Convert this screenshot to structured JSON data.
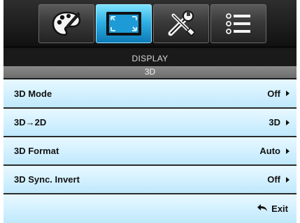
{
  "tabs": [
    {
      "icon": "palette-icon",
      "active": false
    },
    {
      "icon": "display-icon",
      "active": true
    },
    {
      "icon": "tools-icon",
      "active": false
    },
    {
      "icon": "list-icon",
      "active": false
    }
  ],
  "header": {
    "title": "DISPLAY",
    "subtitle": "3D"
  },
  "menu": {
    "items": [
      {
        "label": "3D Mode",
        "value": "Off"
      },
      {
        "label": "3D→2D",
        "value": "3D"
      },
      {
        "label": "3D Format",
        "value": "Auto"
      },
      {
        "label": "3D Sync. Invert",
        "value": "Off"
      }
    ],
    "exit_label": "Exit"
  },
  "colors": {
    "active_tab": "#2fb1e6",
    "row_background": "#d2f0ff",
    "osd_background": "#1c1c1c"
  }
}
